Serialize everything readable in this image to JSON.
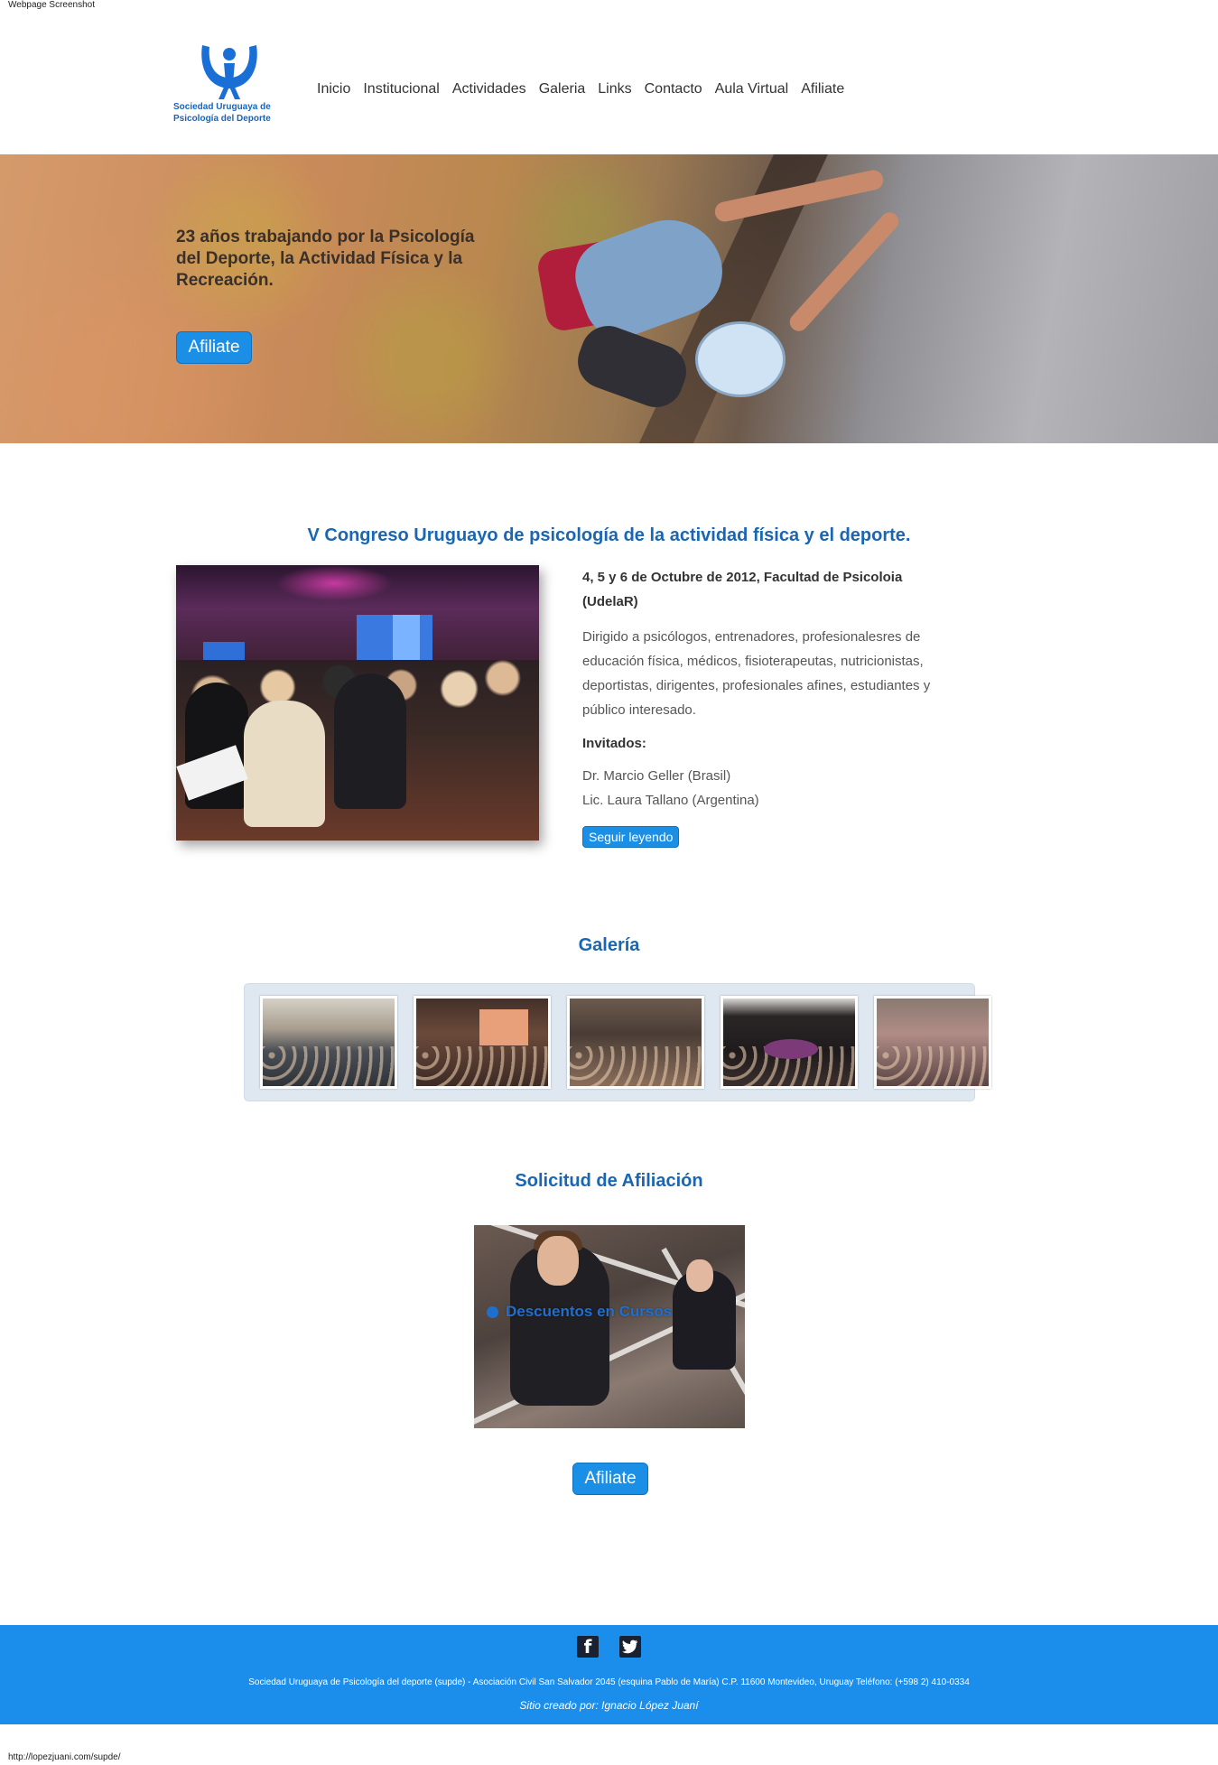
{
  "captions": {
    "top": "Webpage Screenshot",
    "bottom": "http://lopezjuani.com/supde/"
  },
  "header": {
    "logo_line1": "Sociedad Uruguaya de",
    "logo_line2": "Psicología del Deporte",
    "nav": [
      "Inicio",
      "Institucional",
      "Actividades",
      "Galeria",
      "Links",
      "Contacto",
      "Aula Virtual",
      "Afiliate"
    ]
  },
  "hero": {
    "text": "23 años trabajando por la Psicología del Deporte, la Actividad Física y la Recreación.",
    "button": "Afiliate"
  },
  "congress": {
    "title": "V Congreso Uruguayo de psicología de la actividad física y el deporte.",
    "date": "4, 5 y 6 de Octubre de 2012, Facultad de Psicoloia (UdelaR)",
    "description": "Dirigido a psicólogos, entrenadores, profesionalesres de educación física, médicos, fisioterapeutas, nutricionistas, deportistas, dirigentes, profesionales afines, estudiantes y público interesado.",
    "invited_label": "Invitados:",
    "guest1": "Dr. Marcio Geller (Brasil)",
    "guest2": "Lic. Laura Tallano (Argentina)",
    "read_more": "Seguir leyendo"
  },
  "gallery": {
    "title": "Galería"
  },
  "affiliation": {
    "title": "Solicitud de Afiliación",
    "image_caption": "Descuentos en Cursos",
    "button": "Afiliate"
  },
  "footer": {
    "facebook_glyph": "f",
    "twitter_glyph": "t",
    "address": "Sociedad Uruguaya de Psicología del deporte (supde) - Asociación Civil San Salvador 2045 (esquina Pablo de María) C.P. 11600 Montevideo, Uruguay Teléfono: (+598 2) 410-0334",
    "credit": "Sitio creado por: Ignacio López Juaní"
  },
  "colors": {
    "accent": "#1b8fe6",
    "title_blue": "#1a66b2",
    "footer_bg": "#1b8eeb"
  }
}
